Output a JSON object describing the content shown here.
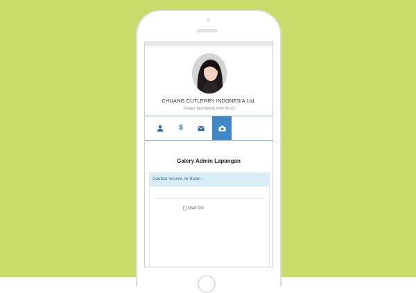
{
  "colors": {
    "background": "#c9dc6a",
    "accent": "#3f88c8",
    "icon": "#2e6da4",
    "panel_heading_bg": "#d9edf7",
    "panel_heading_text": "#31708f"
  },
  "profile": {
    "company_name": "CHUANG CUTLERRY INDONESIA Ltd.",
    "address": "Jl.Raya Tajur/Bantar Pete No.22"
  },
  "tabs": [
    {
      "icon": "user-icon",
      "glyph": "👤",
      "active": false
    },
    {
      "icon": "dollar-icon",
      "glyph": "$",
      "active": false
    },
    {
      "icon": "envelope-icon",
      "glyph": "✉",
      "active": false
    },
    {
      "icon": "camera-icon",
      "glyph": "📷",
      "active": true
    }
  ],
  "main": {
    "title": "Galery Admin Lapangan",
    "panel_heading": "Gambar Volume Air Bulan :",
    "image_alt": "User Pic"
  }
}
